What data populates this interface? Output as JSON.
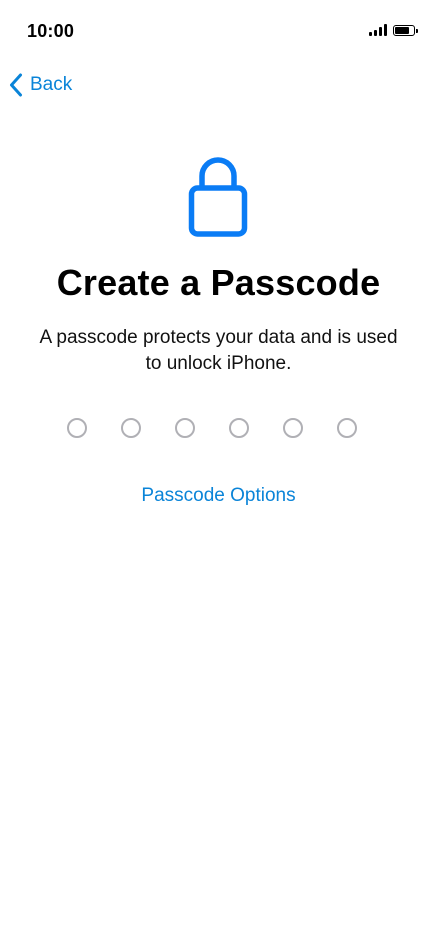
{
  "status_bar": {
    "time": "10:00",
    "signal_icon": "cellular-signal-icon",
    "battery_icon": "battery-icon",
    "battery_level": 0.9
  },
  "nav": {
    "back_label": "Back",
    "back_icon": "chevron-left-icon"
  },
  "header": {
    "icon": "lock-icon",
    "title": "Create a Passcode",
    "subtitle_line1": "A passcode protects your data and is used",
    "subtitle_line2": "to unlock iPhone."
  },
  "passcode": {
    "digits": 6,
    "entered": 0
  },
  "options_link": "Passcode Options",
  "colors": {
    "accent": "#0a84d8",
    "lock": "#0a7cf5",
    "dot_border": "#b0b0b5"
  }
}
